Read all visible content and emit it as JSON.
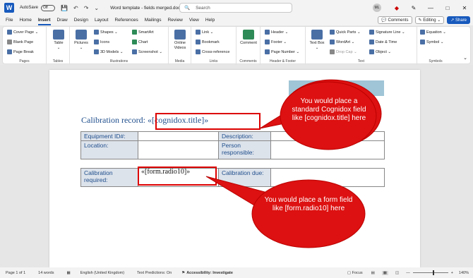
{
  "titlebar": {
    "app_icon": "word-icon",
    "autosave_label": "AutoSave",
    "autosave_state": "Off",
    "doc_title": "Word template - fields merged.docx",
    "search_placeholder": "Search",
    "user_initials": "ML"
  },
  "menu": {
    "items": [
      "File",
      "Home",
      "Insert",
      "Draw",
      "Design",
      "Layout",
      "References",
      "Mailings",
      "Review",
      "View",
      "Help"
    ],
    "active": "Insert",
    "comments": "Comments",
    "editing": "Editing",
    "share": "Share"
  },
  "ribbon": {
    "pages": {
      "label": "Pages",
      "cover": "Cover Page",
      "blank": "Blank Page",
      "break": "Page Break"
    },
    "tables": {
      "label": "Tables",
      "table": "Table"
    },
    "illustrations": {
      "label": "Illustrations",
      "pictures": "Pictures",
      "shapes": "Shapes",
      "icons": "Icons",
      "models": "3D Models",
      "smartart": "SmartArt",
      "chart": "Chart",
      "screenshot": "Screenshot"
    },
    "media": {
      "label": "Media",
      "online_videos": "Online Videos"
    },
    "links": {
      "label": "Links",
      "link": "Link",
      "bookmark": "Bookmark",
      "cross_ref": "Cross-reference"
    },
    "comments": {
      "label": "Comments",
      "comment": "Comment"
    },
    "header_footer": {
      "label": "Header & Footer",
      "header": "Header",
      "footer": "Footer",
      "page_number": "Page Number"
    },
    "text": {
      "label": "Text",
      "text_box": "Text Box",
      "quick_parts": "Quick Parts",
      "wordart": "WordArt",
      "drop_cap": "Drop Cap",
      "signature": "Signature Line",
      "date_time": "Date & Time",
      "object": "Object"
    },
    "symbols": {
      "label": "Symbols",
      "equation": "Equation",
      "symbol": "Symbol"
    }
  },
  "document": {
    "title_prefix": "Calibration record: ",
    "title_field": "«[cognidox.title]»",
    "table1": [
      [
        "Equipment ID#:",
        "",
        "Description:",
        ""
      ],
      [
        "Location:",
        "",
        "Person responsible:",
        ""
      ]
    ],
    "table2": [
      [
        "Calibration required:",
        "«[form.radio10]»",
        "Calibration due:",
        ""
      ]
    ]
  },
  "callouts": {
    "top": "You would place a standard Cognidox field like [cognidox.title] here",
    "bottom": "You would place a form field like [form.radio10] here"
  },
  "status": {
    "page": "Page 1 of 1",
    "words": "14 words",
    "language": "English (United Kingdom)",
    "predictions": "Text Predictions: On",
    "accessibility": "Accessibility: Investigate",
    "focus": "Focus",
    "zoom": "140%",
    "zoom_fraction": 0.57
  }
}
